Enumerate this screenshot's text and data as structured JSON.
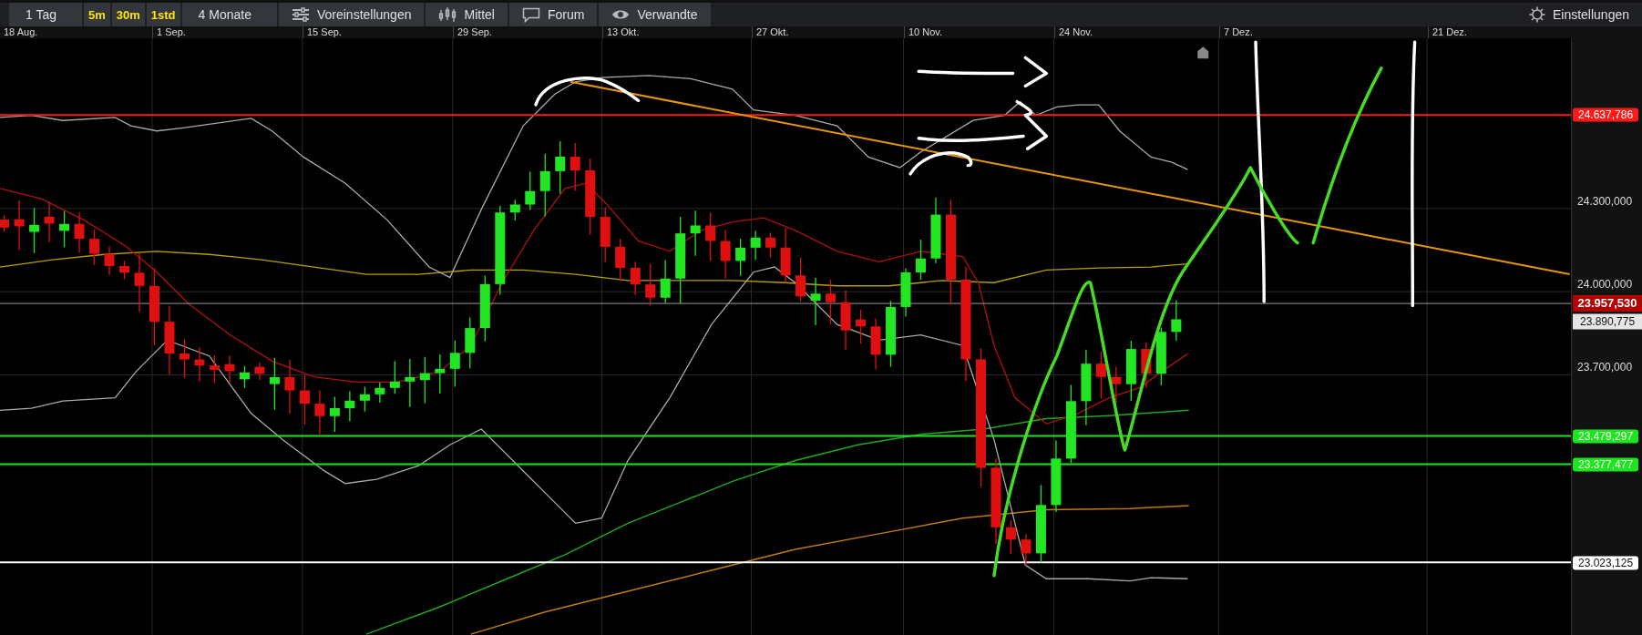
{
  "toolbar": {
    "items": [
      {
        "kind": "range",
        "label": "1 Tag"
      },
      {
        "kind": "interval",
        "label": "5m"
      },
      {
        "kind": "interval",
        "label": "30m"
      },
      {
        "kind": "interval",
        "label": "1std"
      },
      {
        "kind": "range",
        "label": "4 Monate"
      },
      {
        "kind": "presets",
        "label": "Voreinstellungen"
      },
      {
        "kind": "indicators",
        "label": "Mittel"
      },
      {
        "kind": "forum",
        "label": "Forum"
      },
      {
        "kind": "related",
        "label": "Verwandte"
      }
    ],
    "settings": {
      "label": "Einstellungen"
    }
  },
  "chart": {
    "x_labels": [
      "18 Aug.",
      "1 Sep.",
      "15 Sep.",
      "29 Sep.",
      "13 Okt.",
      "27 Okt.",
      "10 Nov.",
      "24 Nov.",
      "7 Dez.",
      "21 Dez."
    ],
    "y_ticks": [
      "24.300,000",
      "24.000,000",
      "23.700,000"
    ],
    "price_tags": [
      {
        "kind": "level",
        "label": "24.637,786",
        "color": "#ff1a1a"
      },
      {
        "kind": "last",
        "label": "23.957,530",
        "color": "#b30000"
      },
      {
        "kind": "quote",
        "label": "23.890,775",
        "color": "#e6e6e6"
      },
      {
        "kind": "level",
        "label": "23.479,297",
        "color": "#1ee61e"
      },
      {
        "kind": "level",
        "label": "23.377,477",
        "color": "#1ee61e"
      },
      {
        "kind": "level",
        "label": "23.023,125",
        "color": "#ffffff"
      }
    ]
  }
}
